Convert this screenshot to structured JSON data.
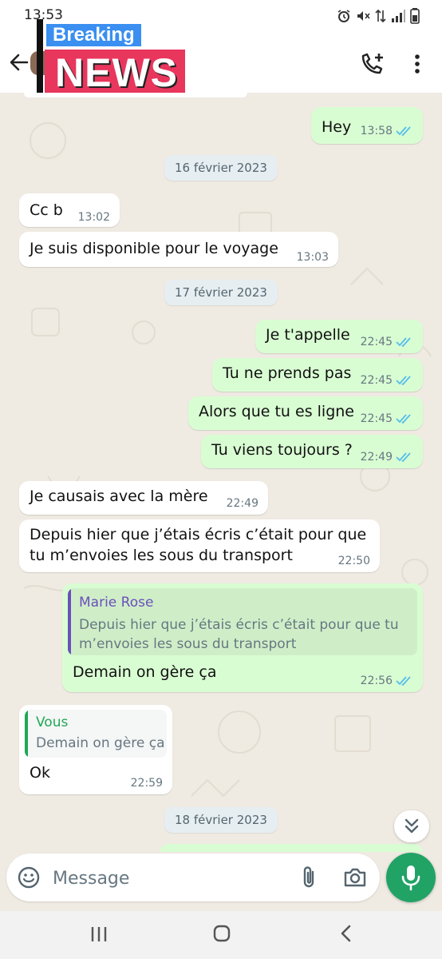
{
  "status_bar": {
    "time": "13:53"
  },
  "header": {
    "sticker_top": "Breaking",
    "sticker_bottom": "NEWS"
  },
  "messages": [
    {
      "dir": "out",
      "text": "Hey",
      "time": "13:58",
      "read": true
    },
    {
      "dir": "date",
      "text": "16 février 2023"
    },
    {
      "dir": "in",
      "text": "Cc b",
      "time": "13:02"
    },
    {
      "dir": "in",
      "text": "Je suis disponible pour le voyage",
      "time": "13:03"
    },
    {
      "dir": "date",
      "text": "17 février 2023"
    },
    {
      "dir": "out",
      "text": "Je t'appelle",
      "time": "22:45",
      "read": true
    },
    {
      "dir": "out",
      "text": "Tu ne prends pas",
      "time": "22:45",
      "read": true
    },
    {
      "dir": "out",
      "text": "Alors que tu es ligne",
      "time": "22:45",
      "read": true
    },
    {
      "dir": "out",
      "text": "Tu viens toujours ?",
      "time": "22:49",
      "read": true
    },
    {
      "dir": "in",
      "text": "Je causais avec la mère",
      "time": "22:49"
    },
    {
      "dir": "in",
      "text": "Depuis hier que j’étais écris c’était pour que\ntu m’envoies les sous du transport",
      "time": "22:50"
    },
    {
      "dir": "out",
      "text": "Demain on gère ça",
      "time": "22:56",
      "read": true,
      "quote": {
        "author": "Marie Rose",
        "text": "Depuis hier que j’étais écris c’était pour que tu\nm’envoies les sous du transport"
      }
    },
    {
      "dir": "in",
      "text": "Ok",
      "time": "22:59",
      "quote": {
        "author": "Vous",
        "text": "Demain on gère ça"
      }
    },
    {
      "dir": "date",
      "text": "18 février 2023"
    }
  ],
  "composer": {
    "placeholder": "Message"
  },
  "colors": {
    "wallpaper": "#efeae2",
    "outgoing_bubble": "#d9fdd3",
    "incoming_bubble": "#ffffff",
    "read_ticks": "#53bdeb",
    "accent_green": "#21a366",
    "quote_author_purple": "#6b4fbb",
    "quote_author_green": "#1fa855"
  },
  "icons": {
    "header": [
      "back-arrow-icon",
      "add-call-icon",
      "more-vert-icon"
    ],
    "composer": [
      "emoji-icon",
      "attach-icon",
      "camera-icon",
      "mic-icon"
    ],
    "navbar": [
      "recent-apps-icon",
      "home-icon",
      "nav-back-icon"
    ],
    "status": [
      "alarm-icon",
      "mute-icon",
      "data-icon",
      "signal-icon",
      "battery-icon"
    ]
  }
}
